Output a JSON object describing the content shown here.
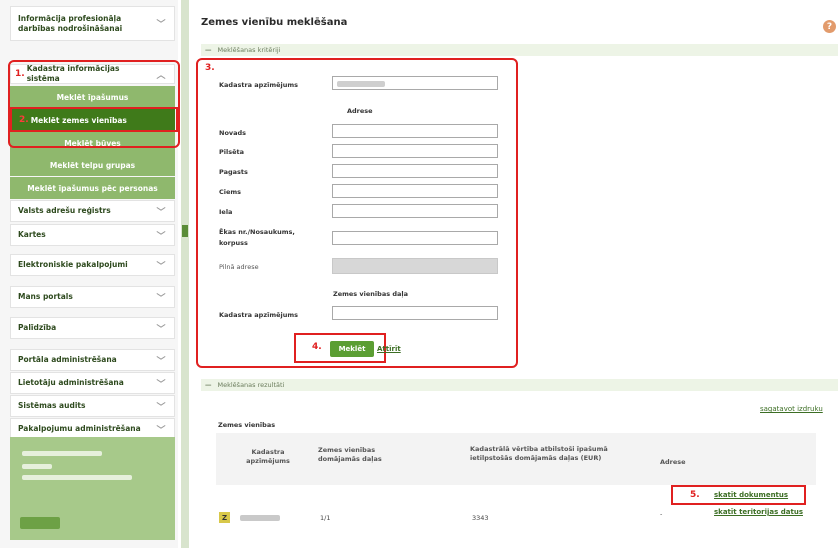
{
  "sidebar": {
    "items": [
      {
        "label": "Informācija profesionāļa darbības nodrošināšanai"
      },
      {
        "label": "Kadastra informācijas sistēma",
        "step": "1."
      },
      {
        "label": "Valsts adrešu reģistrs"
      },
      {
        "label": "Kartes"
      },
      {
        "label": "Elektroniskie pakalpojumi"
      },
      {
        "label": "Mans portals"
      },
      {
        "label": "Palīdzība"
      },
      {
        "label": "Portāla administrēšana"
      },
      {
        "label": "Lietotāju administrēšana"
      },
      {
        "label": "Sistēmas audits"
      },
      {
        "label": "Pakalpojumu administrēšana"
      }
    ],
    "subitems": [
      {
        "label": "Meklēt īpašumus"
      },
      {
        "label": "Meklēt zemes vienības",
        "step": "2."
      },
      {
        "label": "Meklēt būves"
      },
      {
        "label": "Meklēt telpu grupas"
      },
      {
        "label": "Meklēt īpašumus pēc personas"
      }
    ]
  },
  "main": {
    "title": "Zemes vienību meklēšana",
    "help_icon": "?",
    "criteria": {
      "header": "Meklēšanas kritēriji",
      "step": "3.",
      "cadastre_label": "Kadastra apzīmējums",
      "address_heading": "Adrese",
      "fields": [
        {
          "label": "Novads"
        },
        {
          "label": "Pilsēta"
        },
        {
          "label": "Pagasts"
        },
        {
          "label": "Ciems"
        },
        {
          "label": "Iela"
        },
        {
          "label": "Ēkas nr./Nosaukums, korpuss"
        },
        {
          "label": "Pilnā adrese"
        }
      ],
      "land_part_heading": "Zemes vienības daļa",
      "land_part_label": "Kadastra apzīmējums",
      "search_step": "4.",
      "search_button": "Meklēt",
      "clear_link": "Attīrīt"
    },
    "results": {
      "header": "Meklēšanas rezultāti",
      "print_link": "sagatavot izdruku",
      "caption": "Zemes vienības",
      "columns": [
        "Kadastra apzīmējums",
        "Zemes vienības domājamās daļas",
        "Kadastrālā vērtība atbilstoši īpašumā ietilpstošās domājamās daļas (EUR)",
        "Adrese"
      ],
      "row": {
        "icon_letter": "Z",
        "share": "1/1",
        "value": "3343",
        "address": "-",
        "docs_step": "5.",
        "docs_link": "skatīt dokumentus",
        "owners_link": "skatīt teritorijas datus"
      }
    }
  }
}
